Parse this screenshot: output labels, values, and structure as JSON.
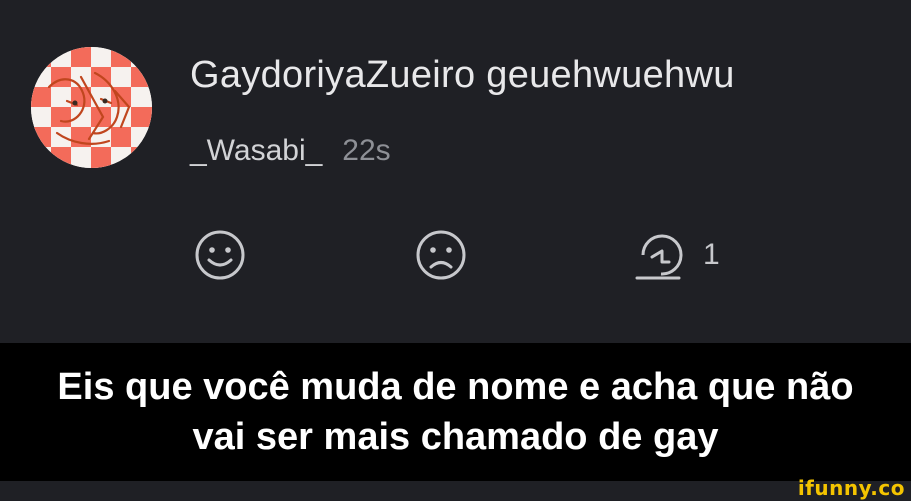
{
  "post": {
    "title": "GaydoriyaZueiro geuehwuehwu",
    "username": "_Wasabi_",
    "timestamp": "22s",
    "reply_count": "1"
  },
  "actions": {
    "like_icon": "smile-icon",
    "dislike_icon": "frown-icon",
    "reply_icon": "reply-icon"
  },
  "caption": {
    "line1": "Eis que você muda de nome e acha que não",
    "line2": "vai ser mais chamado de gay"
  },
  "watermark": "ifunny.co",
  "colors": {
    "background": "#1f2025",
    "caption_background": "#000000",
    "watermark": "#f4c400",
    "avatar_accent": "#f36b5a"
  }
}
